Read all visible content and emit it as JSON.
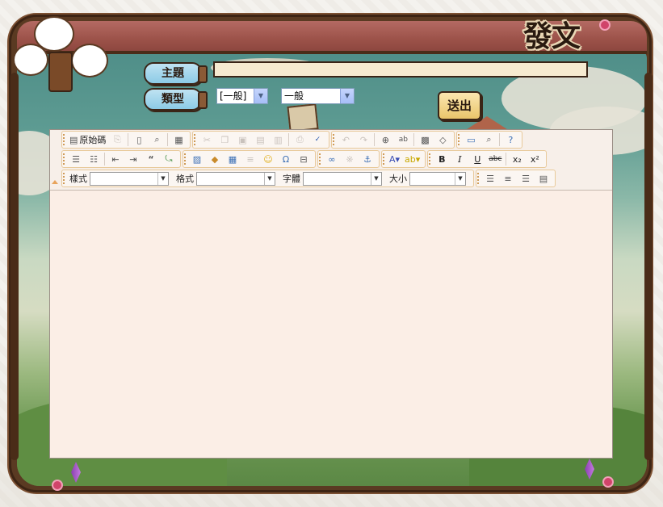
{
  "page": {
    "title": "發文"
  },
  "form": {
    "subject_label": "主題",
    "type_label": "類型",
    "subject_value": "",
    "type_select_1": "[一般]",
    "type_select_2": "一般",
    "send_label": "送出"
  },
  "toolbar": {
    "source_label": "原始碼",
    "style_label": "樣式",
    "format_label": "格式",
    "font_label": "字體",
    "size_label": "大小",
    "style_value": "",
    "format_value": "",
    "font_value": "",
    "size_value": ""
  },
  "icons": {
    "row1": [
      "source-icon",
      "paste-disabled-icon",
      "new-page-icon",
      "preview-icon",
      "templates-icon",
      "cut-icon",
      "copy-icon",
      "paste-icon",
      "paste-text-icon",
      "paste-word-icon",
      "print-icon",
      "spellcheck-icon",
      "undo-icon",
      "redo-icon",
      "find-icon",
      "replace-icon",
      "select-all-icon",
      "remove-format-icon",
      "maximize-icon",
      "show-blocks-icon",
      "about-icon"
    ],
    "row2": [
      "numbered-list-icon",
      "bulleted-list-icon",
      "outdent-icon",
      "indent-icon",
      "blockquote-icon",
      "div-icon",
      "image-icon",
      "flash-icon",
      "table-icon",
      "horizontal-rule-icon",
      "smiley-icon",
      "special-char-icon",
      "page-break-icon",
      "link-icon",
      "unlink-icon",
      "anchor-icon",
      "text-color-icon",
      "bg-color-icon",
      "bold-icon",
      "italic-icon",
      "underline-icon",
      "strike-icon",
      "subscript-icon",
      "superscript-icon"
    ],
    "row3": [
      "align-left-icon",
      "align-center-icon",
      "align-right-icon",
      "justify-icon"
    ]
  },
  "colors": {
    "frame": "#5a3a22",
    "header": "#9c5249",
    "pill": "#8ccbe6",
    "editor_bg": "#fbeee6",
    "input_bg": "#f6ead0"
  }
}
